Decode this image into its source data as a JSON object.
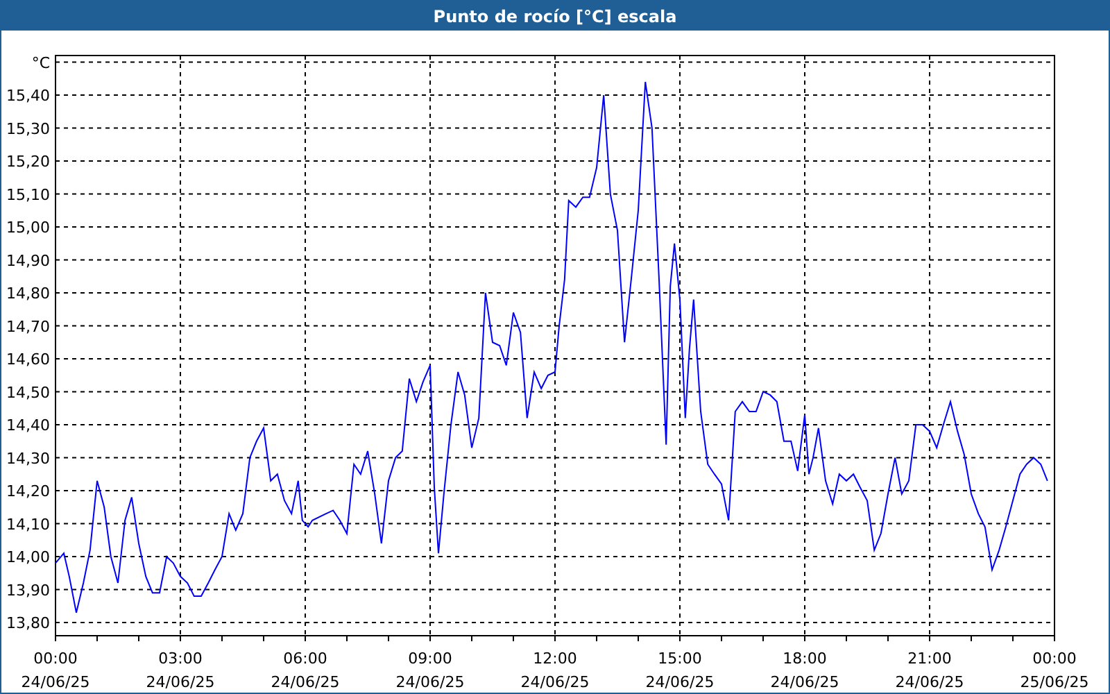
{
  "window": {
    "title": "Punto de rocío [°C] escala"
  },
  "chart": {
    "chart_data": {
      "type": "line",
      "ylim": [
        13.76,
        15.52
      ],
      "xlim": [
        0,
        24
      ],
      "yticks": [
        {
          "value": 13.8,
          "label": "13,80"
        },
        {
          "value": 13.9,
          "label": "13,90"
        },
        {
          "value": 14.0,
          "label": "14,00"
        },
        {
          "value": 14.1,
          "label": "14,10"
        },
        {
          "value": 14.2,
          "label": "14,20"
        },
        {
          "value": 14.3,
          "label": "14,30"
        },
        {
          "value": 14.4,
          "label": "14,40"
        },
        {
          "value": 14.5,
          "label": "14,50"
        },
        {
          "value": 14.6,
          "label": "14,60"
        },
        {
          "value": 14.7,
          "label": "14,70"
        },
        {
          "value": 14.8,
          "label": "14,80"
        },
        {
          "value": 14.9,
          "label": "14,90"
        },
        {
          "value": 15.0,
          "label": "15,00"
        },
        {
          "value": 15.1,
          "label": "15,10"
        },
        {
          "value": 15.2,
          "label": "15,20"
        },
        {
          "value": 15.3,
          "label": "15,30"
        },
        {
          "value": 15.4,
          "label": "15,40"
        },
        {
          "value": 15.5,
          "label": "°C"
        }
      ],
      "grid": true,
      "xticks": [
        {
          "value": 0,
          "label": "00:00"
        },
        {
          "value": 3,
          "label": "03:00"
        },
        {
          "value": 6,
          "label": "06:00"
        },
        {
          "value": 9,
          "label": "09:00"
        },
        {
          "value": 12,
          "label": "12:00"
        },
        {
          "value": 15,
          "label": "15:00"
        },
        {
          "value": 18,
          "label": "18:00"
        },
        {
          "value": 21,
          "label": "21:00"
        },
        {
          "value": 24,
          "label": "00:00"
        }
      ],
      "annotations": [
        "24/06/25",
        "24/06/25",
        "24/06/25",
        "24/06/25",
        "24/06/25",
        "24/06/25",
        "24/06/25",
        "24/06/25",
        "25/06/25"
      ],
      "x": [
        0,
        0.2,
        0.33,
        0.5,
        0.67,
        0.83,
        1,
        1.17,
        1.33,
        1.5,
        1.67,
        1.83,
        2,
        2.17,
        2.33,
        2.5,
        2.67,
        2.83,
        3,
        3.17,
        3.33,
        3.5,
        3.67,
        3.83,
        4,
        4.17,
        4.33,
        4.5,
        4.67,
        4.83,
        5,
        5.17,
        5.33,
        5.5,
        5.67,
        5.83,
        5.93,
        6.07,
        6.17,
        6.5,
        6.67,
        6.83,
        7,
        7.17,
        7.33,
        7.5,
        7.67,
        7.83,
        8,
        8.17,
        8.33,
        8.5,
        8.67,
        8.83,
        9,
        9.1,
        9.2,
        9.33,
        9.5,
        9.67,
        9.83,
        10,
        10.17,
        10.33,
        10.5,
        10.67,
        10.83,
        11,
        11.17,
        11.33,
        11.5,
        11.67,
        11.83,
        12,
        12.1,
        12.23,
        12.33,
        12.5,
        12.67,
        12.83,
        13,
        13.17,
        13.33,
        13.5,
        13.67,
        13.83,
        14,
        14.17,
        14.33,
        14.5,
        14.67,
        14.77,
        14.87,
        15,
        15.13,
        15.23,
        15.33,
        15.5,
        15.67,
        15.83,
        16,
        16.17,
        16.33,
        16.5,
        16.67,
        16.83,
        17,
        17.17,
        17.33,
        17.5,
        17.67,
        17.83,
        18,
        18.1,
        18.2,
        18.33,
        18.5,
        18.67,
        18.83,
        19,
        19.17,
        19.33,
        19.5,
        19.67,
        19.83,
        20,
        20.17,
        20.33,
        20.5,
        20.67,
        20.83,
        21,
        21.17,
        21.33,
        21.5,
        21.67,
        21.83,
        22,
        22.17,
        22.33,
        22.5,
        22.67,
        22.83,
        23,
        23.17,
        23.33,
        23.5,
        23.67,
        23.83
      ],
      "series": [
        {
          "color": "#0000ff",
          "values": [
            13.98,
            14.01,
            13.94,
            13.83,
            13.92,
            14.02,
            14.23,
            14.15,
            14.0,
            13.92,
            14.11,
            14.18,
            14.04,
            13.94,
            13.89,
            13.89,
            14.0,
            13.98,
            13.94,
            13.92,
            13.88,
            13.88,
            13.92,
            13.96,
            14.0,
            14.13,
            14.08,
            14.13,
            14.3,
            14.35,
            14.39,
            14.23,
            14.25,
            14.17,
            14.13,
            14.23,
            14.11,
            14.09,
            14.11,
            14.13,
            14.14,
            14.11,
            14.07,
            14.28,
            14.25,
            14.32,
            14.19,
            14.04,
            14.23,
            14.3,
            14.32,
            14.54,
            14.47,
            14.53,
            14.58,
            14.21,
            14.01,
            14.19,
            14.4,
            14.56,
            14.49,
            14.33,
            14.42,
            14.8,
            14.65,
            14.64,
            14.58,
            14.74,
            14.68,
            14.42,
            14.56,
            14.51,
            14.55,
            14.56,
            14.7,
            14.84,
            15.08,
            15.06,
            15.09,
            15.09,
            15.18,
            15.4,
            15.1,
            14.99,
            14.65,
            14.84,
            15.05,
            15.44,
            15.3,
            14.84,
            14.34,
            14.82,
            14.95,
            14.78,
            14.42,
            14.63,
            14.78,
            14.44,
            14.28,
            14.25,
            14.22,
            14.11,
            14.44,
            14.47,
            14.44,
            14.44,
            14.5,
            14.49,
            14.47,
            14.35,
            14.35,
            14.26,
            14.43,
            14.25,
            14.3,
            14.39,
            14.23,
            14.16,
            14.25,
            14.23,
            14.25,
            14.21,
            14.17,
            14.02,
            14.07,
            14.19,
            14.3,
            14.19,
            14.23,
            14.4,
            14.4,
            14.38,
            14.33,
            14.4,
            14.47,
            14.38,
            14.31,
            14.19,
            14.13,
            14.09,
            13.96,
            14.02,
            14.09,
            14.17,
            14.25,
            14.28,
            14.3,
            14.28,
            14.23
          ]
        }
      ]
    }
  }
}
